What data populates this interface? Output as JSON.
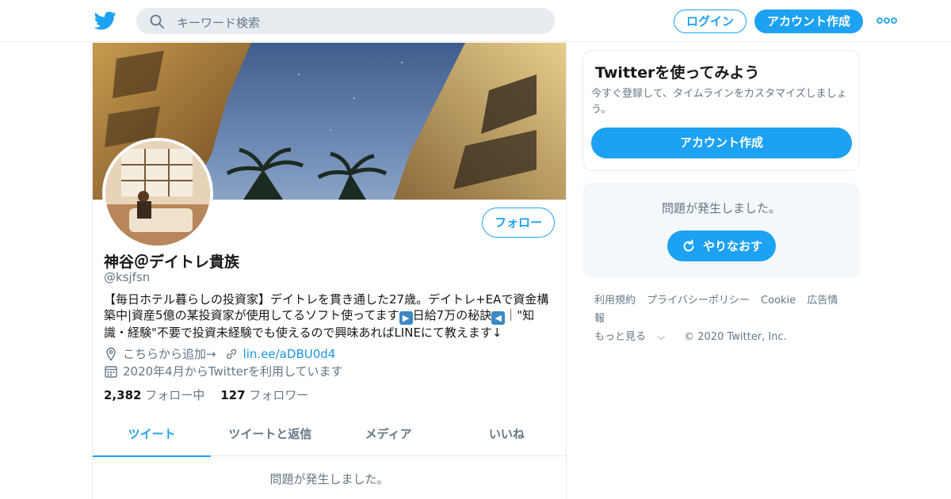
{
  "header": {
    "logo_icon": "twitter-bird-icon",
    "search_placeholder": "キーワード検索",
    "login_label": "ログイン",
    "signup_label": "アカウント作成",
    "more_icon": "more-dots-icon",
    "accent_color": "#1da1f2"
  },
  "profile": {
    "follow_label": "フォロー",
    "name": "神谷＠デイトレ貴族",
    "handle": "@ksjfsn",
    "bio_part1": "【毎日ホテル暮らしの投資家】デイトレを貫き通した27歳。デイトレ+EAで資金構築中|資産5億の某投資家が使用してるソフト使ってます",
    "bio_emoji1": "▶",
    "bio_part2": "日給7万の秘訣",
    "bio_emoji2": "◀",
    "bio_part3": "｜\"知識・経験\"不要で投資未経験でも使えるので興味あればLINEにて教えます↓",
    "location": "こちらから追加→",
    "url": "lin.ee/aDBU0d4",
    "joined": "2020年4月からTwitterを利用しています",
    "following_count": "2,382",
    "following_label": "フォロー中",
    "followers_count": "127",
    "followers_label": "フォロワー"
  },
  "tabs": [
    {
      "label": "ツイート",
      "active": true
    },
    {
      "label": "ツイートと返信",
      "active": false
    },
    {
      "label": "メディア",
      "active": false
    },
    {
      "label": "いいね",
      "active": false
    }
  ],
  "timeline": {
    "error_message": "問題が発生しました。"
  },
  "sidebar": {
    "signup_card": {
      "title": "Twitterを使ってみよう",
      "subtitle": "今すぐ登録して、タイムラインをカスタマイズしましょう。",
      "button_label": "アカウント作成"
    },
    "error_card": {
      "message": "問題が発生しました。",
      "retry_label": "やりなおす"
    },
    "footer": {
      "links": [
        "利用規約",
        "プライバシーポリシー",
        "Cookie",
        "広告情報"
      ],
      "more_label": "もっと見る",
      "copyright": "© 2020 Twitter, Inc."
    }
  }
}
